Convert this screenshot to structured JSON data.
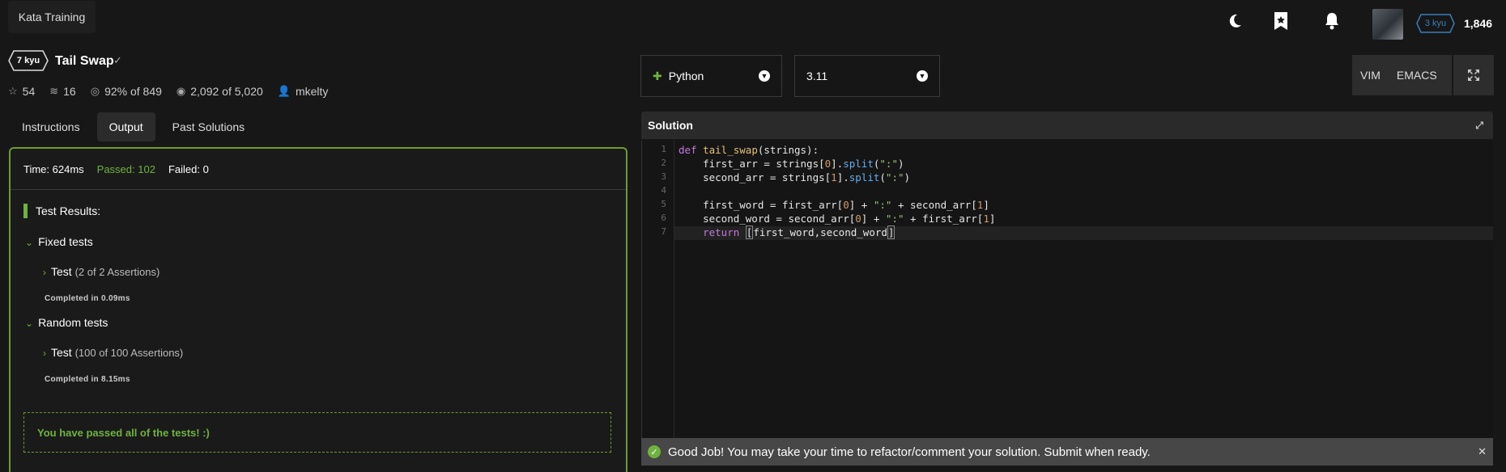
{
  "topbar": {
    "brand": "Kata Training",
    "icons": [
      "moon-icon",
      "bookmark-star-icon",
      "bell-icon"
    ],
    "rank": "3 kyu",
    "honor": "1,846"
  },
  "kata": {
    "kyu": "7 kyu",
    "title": "Tail Swap",
    "stats": {
      "stars": "54",
      "collections": "16",
      "satisfaction": "92% of 849",
      "completed": "2,092 of 5,020",
      "author": "mkelty"
    }
  },
  "tabs": [
    {
      "label": "Instructions"
    },
    {
      "label": "Output"
    },
    {
      "label": "Past Solutions"
    }
  ],
  "output": {
    "time": "Time: 624ms",
    "passed": "Passed: 102",
    "failed": "Failed: 0",
    "results_title": "Test Results:",
    "groups": [
      {
        "name": "Fixed tests",
        "test": "Test",
        "assertions": "(2 of 2 Assertions)",
        "completed": "Completed in 0.09ms"
      },
      {
        "name": "Random tests",
        "test": "Test",
        "assertions": "(100 of 100 Assertions)",
        "completed": "Completed in 8.15ms"
      }
    ],
    "pass_message": "You have passed all of the tests! :)"
  },
  "editor": {
    "language": "Python",
    "version": "3.11",
    "modes": [
      "VIM",
      "EMACS"
    ],
    "solution_label": "Solution",
    "line_numbers": [
      "1",
      "2",
      "3",
      "4",
      "5",
      "6",
      "7"
    ]
  },
  "toast": {
    "message": "Good Job! You may take your time to refactor/comment your solution. Submit when ready."
  },
  "colors": {
    "accent_green": "#6fb33e",
    "rank_blue": "#3c7ebb",
    "output_border": "#6f9a2f"
  }
}
